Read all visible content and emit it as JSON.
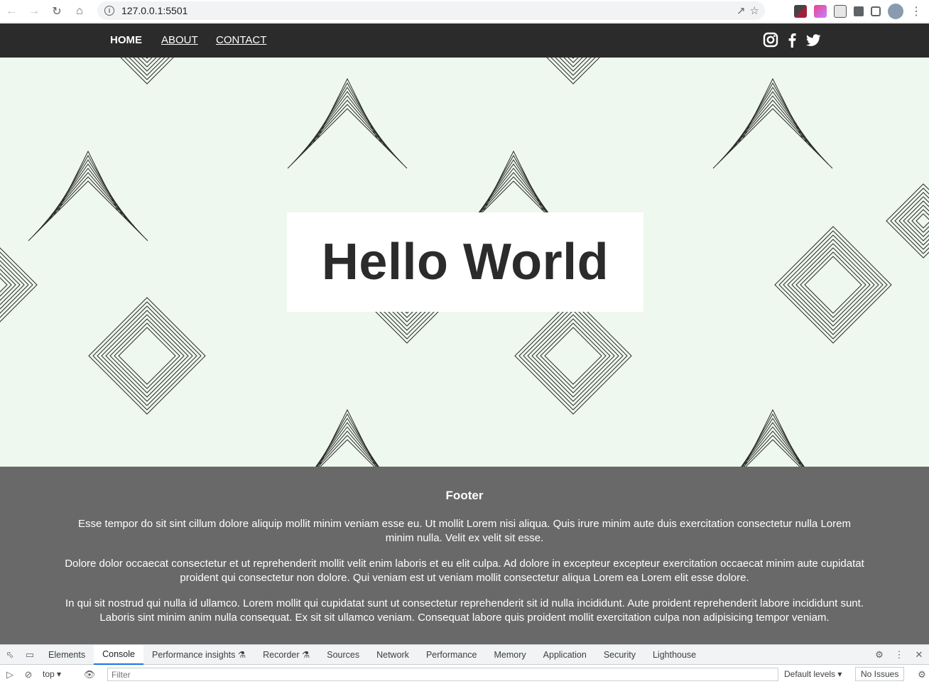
{
  "browser": {
    "url": "127.0.0.1:5501"
  },
  "site_nav": {
    "links": [
      {
        "label": "HOME",
        "active": true
      },
      {
        "label": "ABOUT",
        "active": false
      },
      {
        "label": "CONTACT",
        "active": false
      }
    ],
    "social_icons": [
      "instagram-icon",
      "facebook-icon",
      "twitter-icon"
    ]
  },
  "hero": {
    "title": "Hello World",
    "background_color": "#eef8ee"
  },
  "footer": {
    "heading": "Footer",
    "paragraphs": [
      "Esse tempor do sit sint cillum dolore aliquip mollit minim veniam esse eu. Ut mollit Lorem nisi aliqua. Quis irure minim aute duis exercitation consectetur nulla Lorem minim nulla. Velit ex velit sit esse.",
      "Dolore dolor occaecat consectetur et ut reprehenderit mollit velit enim laboris et eu elit culpa. Ad dolore in excepteur excepteur exercitation occaecat minim aute cupidatat proident qui consectetur non dolore. Qui veniam est ut veniam mollit consectetur aliqua Lorem ea Lorem elit esse dolore.",
      "In qui sit nostrud qui nulla id ullamco. Lorem mollit qui cupidatat sunt ut consectetur reprehenderit sit id nulla incididunt. Aute proident reprehenderit labore incididunt sunt. Laboris sint minim anim nulla consequat. Ex sit sit ullamco veniam. Consequat labore quis proident mollit exercitation culpa non adipisicing tempor veniam."
    ],
    "background_color": "#696969"
  },
  "devtools": {
    "tabs": [
      "Elements",
      "Console",
      "Performance insights",
      "Recorder",
      "Sources",
      "Network",
      "Performance",
      "Memory",
      "Application",
      "Security",
      "Lighthouse"
    ],
    "active_tab": "Console",
    "context": "top",
    "filter_placeholder": "Filter",
    "levels": "Default levels",
    "issues": "No Issues"
  }
}
